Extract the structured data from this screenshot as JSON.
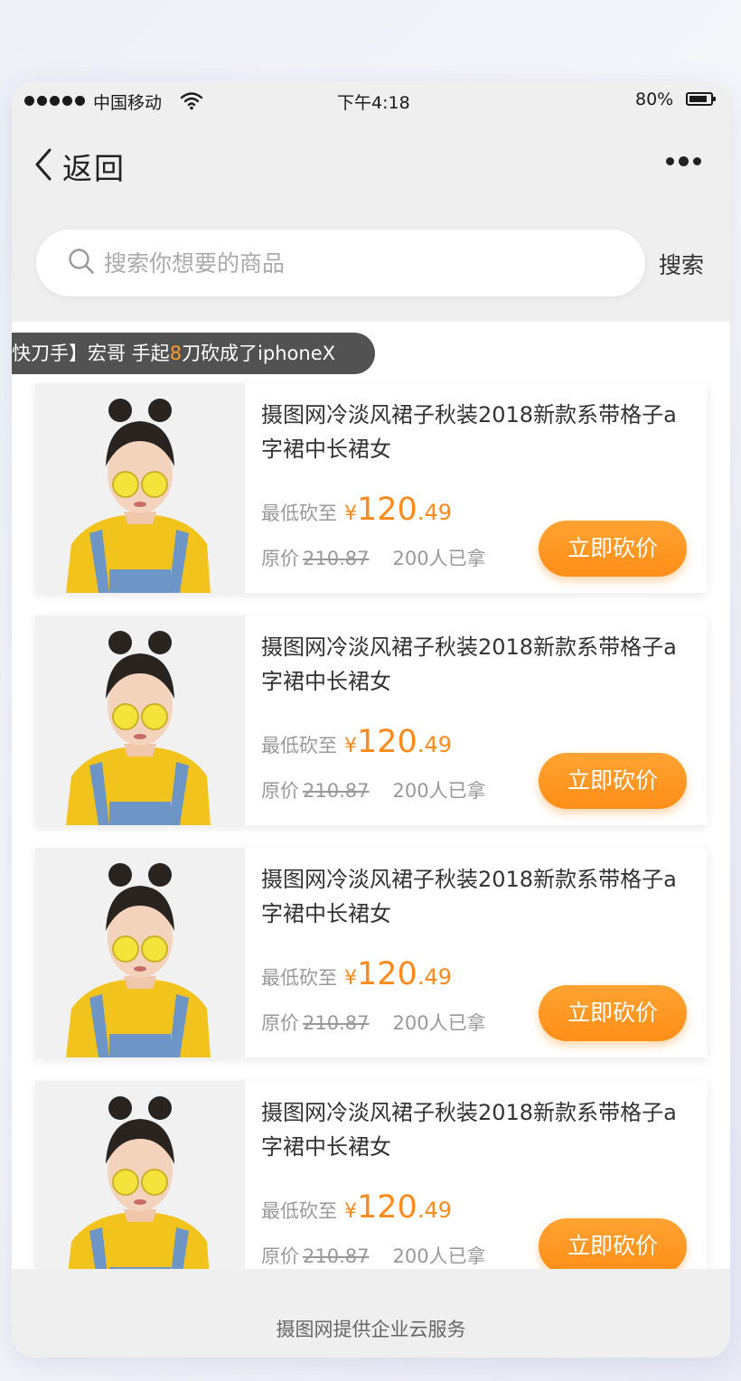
{
  "status_bar": {
    "carrier": "中国移动",
    "time": "下午4:18",
    "battery_percent": "80%"
  },
  "nav": {
    "back_label": "返回"
  },
  "search": {
    "placeholder": "搜索你想要的商品",
    "button_label": "搜索"
  },
  "ticker": {
    "text_before": "快刀手】宏哥 手起",
    "highlight": "8",
    "text_after": "刀砍成了iphoneX"
  },
  "products": [
    {
      "title": "摄图网冷淡风裙子秋装2018新款系带格子a字裙中长裙女",
      "price_label": "最低砍至",
      "currency": "¥",
      "price_int": "120",
      "price_dec": ".49",
      "orig_label": "原价",
      "orig_price": "210.87",
      "sold": "200人已拿",
      "button": "立即砍价"
    },
    {
      "title": "摄图网冷淡风裙子秋装2018新款系带格子a字裙中长裙女",
      "price_label": "最低砍至",
      "currency": "¥",
      "price_int": "120",
      "price_dec": ".49",
      "orig_label": "原价",
      "orig_price": "210.87",
      "sold": "200人已拿",
      "button": "立即砍价"
    },
    {
      "title": "摄图网冷淡风裙子秋装2018新款系带格子a字裙中长裙女",
      "price_label": "最低砍至",
      "currency": "¥",
      "price_int": "120",
      "price_dec": ".49",
      "orig_label": "原价",
      "orig_price": "210.87",
      "sold": "200人已拿",
      "button": "立即砍价"
    },
    {
      "title": "摄图网冷淡风裙子秋装2018新款系带格子a字裙中长裙女",
      "price_label": "最低砍至",
      "currency": "¥",
      "price_int": "120",
      "price_dec": ".49",
      "orig_label": "原价",
      "orig_price": "210.87",
      "sold": "200人已拿",
      "button": "立即砍价"
    }
  ],
  "footer": {
    "text": "摄图网提供企业云服务"
  },
  "colors": {
    "accent": "#ff8e18",
    "ticker_bg": "#525252",
    "page_bg": "#efefef"
  }
}
